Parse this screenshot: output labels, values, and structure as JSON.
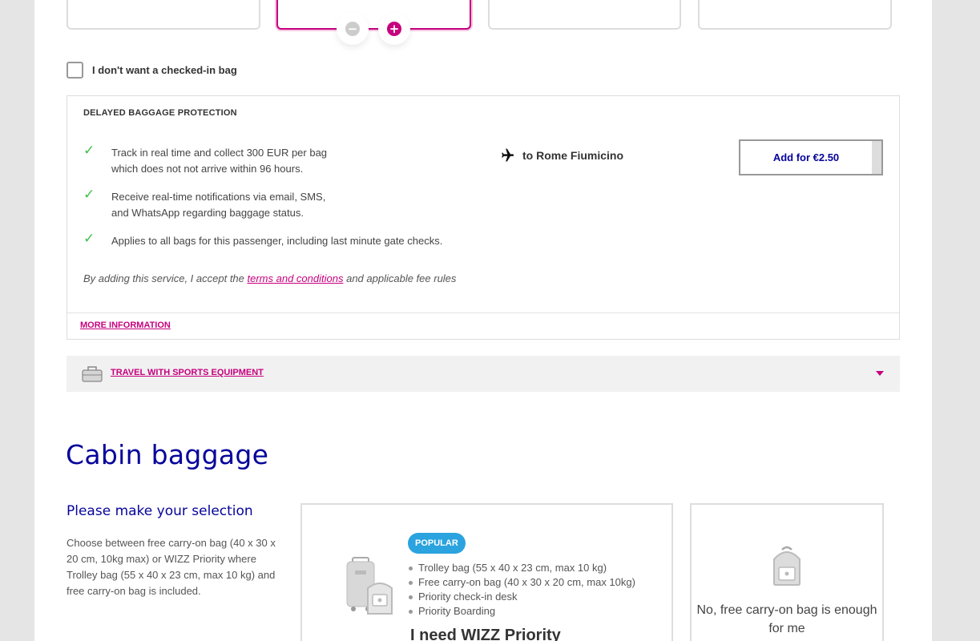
{
  "checked_bag": {
    "no_bag_label": "I don't want a checked-in bag"
  },
  "protection": {
    "title": "DELAYED BAGGAGE PROTECTION",
    "features": [
      {
        "line1": "Track in real time and collect 300 EUR per bag",
        "line2": "which does not not arrive within 96 hours."
      },
      {
        "line1": "Receive real-time notifications via email, SMS,",
        "line2": "and WhatsApp regarding baggage status."
      },
      {
        "line1": "Applies to all bags for this passenger, including last minute gate checks.",
        "line2": ""
      }
    ],
    "terms_prefix": "By adding this service, I accept the",
    "terms_link": "terms and conditions",
    "terms_suffix": "and applicable fee rules",
    "destination": "to Rome Fiumicino",
    "add_button": "Add for €2.50",
    "more_info": "MORE INFORMATION"
  },
  "sports": {
    "label": "TRAVEL WITH SPORTS EQUIPMENT"
  },
  "cabin": {
    "title": "Cabin baggage",
    "subtitle": "Please make your selection",
    "description": "Choose between free carry-on bag (40 x 30 x 20 cm, 10kg max) or WIZZ Priority where Trolley bag (55 x 40 x 23 cm, max 10 kg) and free carry-on bag is included.",
    "priority": {
      "badge": "POPULAR",
      "items": [
        "Trolley bag (55 x 40 x 23 cm, max 10 kg)",
        "Free carry-on bag (40 x 30 x 20 cm, max 10kg)",
        "Priority check-in desk",
        "Priority Boarding"
      ],
      "title": "I need WIZZ Priority"
    },
    "no_priority": {
      "text": "No, free carry-on bag is enough for me"
    }
  },
  "colors": {
    "brand_magenta": "#c6007e",
    "brand_navy": "#06049b",
    "check_green": "#3fbf4b",
    "badge_blue": "#2aa3de"
  }
}
